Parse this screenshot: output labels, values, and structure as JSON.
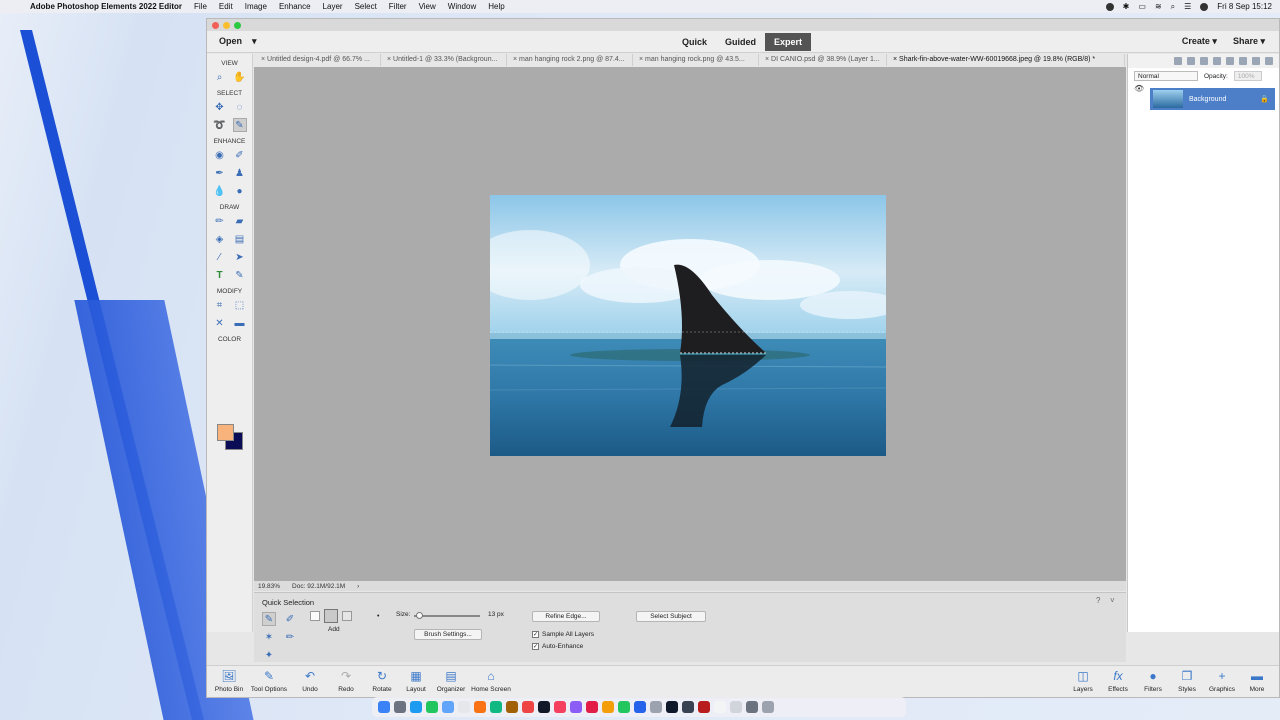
{
  "menubar": {
    "app_name": "Adobe Photoshop Elements 2022 Editor",
    "items": [
      "File",
      "Edit",
      "Image",
      "Enhance",
      "Layer",
      "Select",
      "Filter",
      "View",
      "Window",
      "Help"
    ],
    "clock": "Fri 8 Sep  15:12"
  },
  "topbar": {
    "open_label": "Open",
    "modes": [
      "Quick",
      "Guided",
      "Expert"
    ],
    "active_mode": "Expert",
    "create_label": "Create",
    "share_label": "Share"
  },
  "tabs": [
    "Untitled design-4.pdf @ 66.7% ...",
    "Untitled-1 @ 33.3% (Backgroun...",
    "man hanging rock 2.png @ 87.4...",
    "man hanging rock.png @ 43.5...",
    "DI CANIO.psd @ 38.9% (Layer 1...",
    "Shark-fin-above-water-WW-60019668.jpeg @ 19.8% (RGB/8) *"
  ],
  "toolbox": {
    "sections": [
      "VIEW",
      "SELECT",
      "ENHANCE",
      "DRAW",
      "MODIFY",
      "COLOR"
    ]
  },
  "colors": {
    "foreground": "#f8b27c",
    "background": "#0a0d55",
    "active_mode_bg": "#545454",
    "layer_selected": "#4d7fc9"
  },
  "status": {
    "zoom": "19.83%",
    "doc": "Doc: 92.1M/92.1M"
  },
  "layers": {
    "blend_mode": "Normal",
    "opacity_label": "Opacity:",
    "opacity_value": "100%",
    "items": [
      {
        "name": "Background"
      }
    ]
  },
  "tool_options": {
    "title": "Quick Selection",
    "add_label": "Add",
    "size_label": "Size:",
    "size_value": "13 px",
    "brush_settings": "Brush Settings...",
    "refine_edge": "Refine Edge...",
    "select_subject": "Select Subject",
    "sample_all_layers": "Sample All Layers",
    "auto_enhance": "Auto-Enhance"
  },
  "taskbar": {
    "left": [
      "Photo Bin",
      "Tool Options",
      "Undo",
      "Redo",
      "Rotate",
      "Layout",
      "Organizer",
      "Home Screen"
    ],
    "right": [
      "Layers",
      "Effects",
      "Filters",
      "Styles",
      "Graphics",
      "More"
    ]
  }
}
